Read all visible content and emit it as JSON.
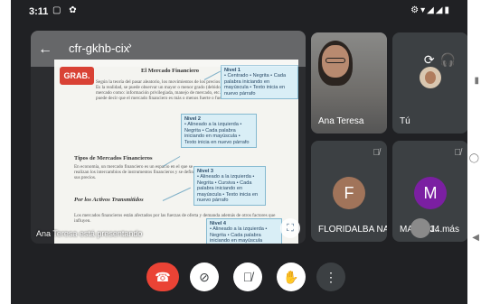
{
  "status_bar": {
    "time": "3:11",
    "left_icons": "▢ ✿",
    "right_icons": "⚙▾◢◢▮"
  },
  "presentation": {
    "meeting_code": "cfr-gkhb-cix",
    "chevron": "›",
    "recording_label": "GRAB.",
    "caption": "Ana Teresa está presentando",
    "document": {
      "heading1": "El Mercado Financiero",
      "heading2": "Tipos de Mercados Financieros",
      "heading3": "Por los Activos Transmitidos",
      "para1": "Según la teoría del pasar aleatorio, los movimientos de los precios no pueden predecir. Es la realidad, se puede observar un mayor o menor grado (debido a ineficiencias del mercado como: información privilegiada, manejo de mercado, etc.), por lo que se puede decir que el mercado financiero es más o menos fuerte o fuerte.",
      "para2": "En economía, un mercado financiero es un espacio en el que se realizan los intercambios de instrumentos financieros y se definen sus precios.",
      "para3": "Los mercados financieros están afectados por las fuerzas de oferta y demanda además de otros factores que influyen."
    },
    "notes": [
      {
        "title": "Nivel 1",
        "body": "• Centrado • Negrita • Cada palabra iniciando en mayúscula • Texto inicia en nuevo párrafo"
      },
      {
        "title": "Nivel 2",
        "body": "• Alineado a la izquierda • Negrita • Cada palabra iniciando en mayúscula • Texto inicia en nuevo párrafo"
      },
      {
        "title": "Nivel 3",
        "body": "• Alineado a la izquierda • Negrita • Cursiva • Cada palabra iniciando en mayúscula • Texto inicia en nuevo párrafo"
      },
      {
        "title": "Nivel 4",
        "body": "• Alineado a la izquierda • Negrita • Cada palabra iniciando en mayúscula"
      }
    ]
  },
  "participants": [
    {
      "name": "Ana Teresa"
    },
    {
      "name": "Tú"
    },
    {
      "name": "FLORIDALBA NAR...",
      "initial": "F",
      "avatar_color": "#a1745a"
    },
    {
      "name": "MARIA J...",
      "initial": "M",
      "avatar_color": "#7b1fa2"
    }
  ],
  "more_participants": "14 más",
  "controls": {
    "end_call": "End call",
    "camera": "Camera off",
    "microphone": "Microphone off",
    "raise_hand": "Raise hand",
    "more": "More options"
  },
  "colors": {
    "background": "#202124",
    "end_call": "#ea4335",
    "recording": "#d94235"
  }
}
